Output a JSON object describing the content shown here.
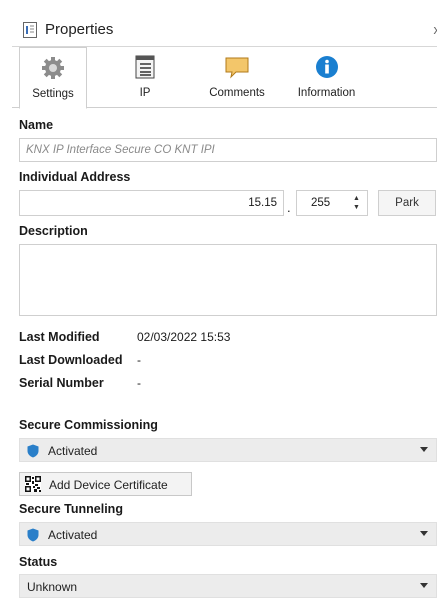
{
  "window": {
    "title": "Properties",
    "close_glyph": "x"
  },
  "tabs": [
    {
      "label": "Settings",
      "icon": "gear-icon",
      "active": true
    },
    {
      "label": "IP",
      "icon": "ip-list-icon",
      "active": false
    },
    {
      "label": "Comments",
      "icon": "comment-icon",
      "active": false
    },
    {
      "label": "Information",
      "icon": "info-icon",
      "active": false
    }
  ],
  "settings": {
    "name_label": "Name",
    "name_placeholder": "KNX IP Interface Secure CO KNT IPI",
    "address_label": "Individual Address",
    "address_value": "15.15",
    "address_separator": ".",
    "address_device": "255",
    "park_label": "Park",
    "description_label": "Description",
    "last_modified_label": "Last Modified",
    "last_modified_value": "02/03/2022 15:53",
    "last_downloaded_label": "Last Downloaded",
    "last_downloaded_value": "-",
    "serial_number_label": "Serial Number",
    "serial_number_value": "-",
    "secure_commissioning_label": "Secure Commissioning",
    "secure_commissioning_value": "Activated",
    "add_certificate_label": "Add Device Certificate",
    "secure_tunneling_label": "Secure Tunneling",
    "secure_tunneling_value": "Activated",
    "status_label": "Status",
    "status_value": "Unknown"
  },
  "colors": {
    "shield": "#2a7fc9",
    "info": "#1a7fd0",
    "comment": "#f3c66a"
  }
}
